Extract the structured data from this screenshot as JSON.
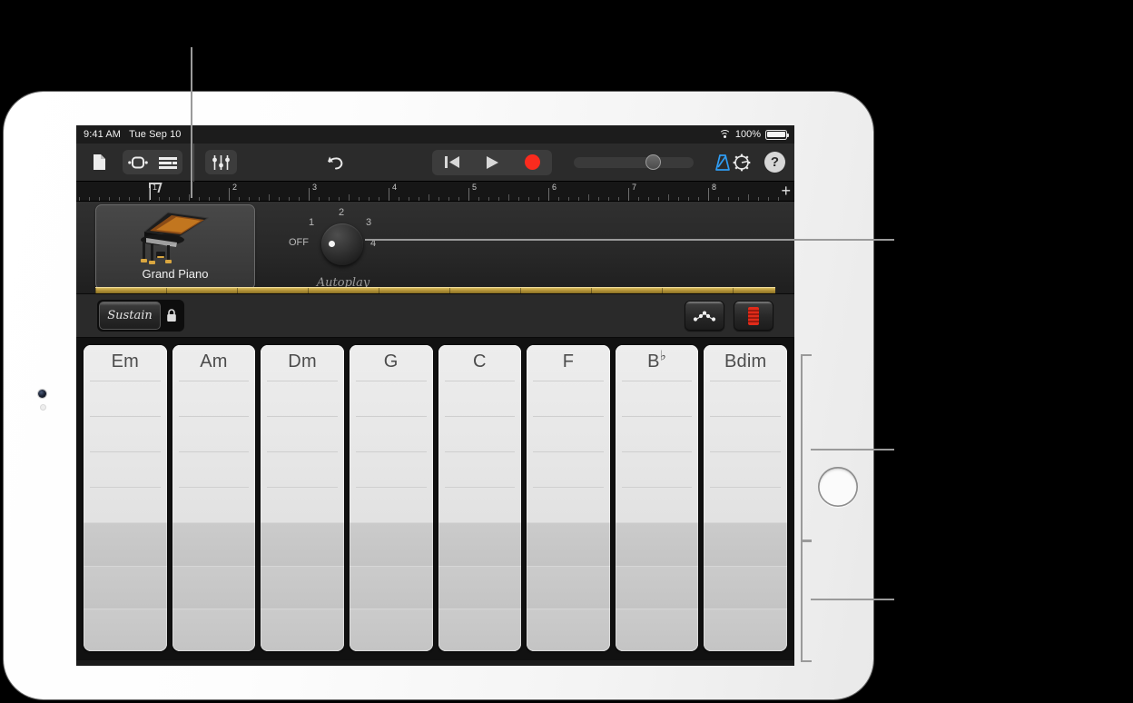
{
  "status_bar": {
    "time": "9:41 AM",
    "date": "Tue Sep 10",
    "battery_percent": "100%",
    "wifi_icon": "wifi-icon",
    "battery_icon": "battery-icon"
  },
  "toolbar": {
    "my_songs_icon": "document-icon",
    "loop_browser_icon": "loop-browser-icon",
    "track_view_icon": "track-view-icon",
    "mixer_icon": "mixer-sliders-icon",
    "undo_icon": "undo-arrow-icon",
    "rewind_icon": "rewind-icon",
    "play_icon": "play-icon",
    "record_icon": "record-icon",
    "master_volume_value": "60",
    "metronome_icon": "metronome-icon",
    "settings_icon": "gear-icon",
    "help_label": "?"
  },
  "ruler": {
    "bars": [
      "1",
      "2",
      "3",
      "4",
      "5",
      "6",
      "7",
      "8"
    ],
    "playhead_bar": "1",
    "add_section_label": "+"
  },
  "panel": {
    "instrument": {
      "name": "Grand Piano",
      "art_icon": "grand-piano-icon"
    },
    "autoplay": {
      "title": "Autoplay",
      "marks": [
        "OFF",
        "1",
        "2",
        "3",
        "4"
      ],
      "selected": "OFF"
    }
  },
  "control_bar": {
    "sustain_label": "Sustain",
    "lock_icon": "lock-icon",
    "arpeggiator_icon": "arpeggiator-notes-icon",
    "chord_strips_icon": "chord-strips-icon",
    "chord_strips_color": "#e02b1a"
  },
  "chord_strips": {
    "chords": [
      {
        "root": "Em",
        "accidental": ""
      },
      {
        "root": "Am",
        "accidental": ""
      },
      {
        "root": "Dm",
        "accidental": ""
      },
      {
        "root": "G",
        "accidental": ""
      },
      {
        "root": "C",
        "accidental": ""
      },
      {
        "root": "F",
        "accidental": ""
      },
      {
        "root": "B",
        "accidental": "♭"
      },
      {
        "root": "Bdim",
        "accidental": ""
      }
    ],
    "upper_zone_count": 5,
    "bass_row_count": 3
  },
  "annotations": {
    "callout_instrument": "instrument-callout-line",
    "callout_autoplay": "autoplay-callout-line",
    "bracket_chords_upper": "chord-upper-region-bracket",
    "bracket_chords_bass": "chord-bass-region-bracket"
  },
  "device": {
    "camera_icon": "front-camera",
    "home_button_icon": "home-button"
  }
}
